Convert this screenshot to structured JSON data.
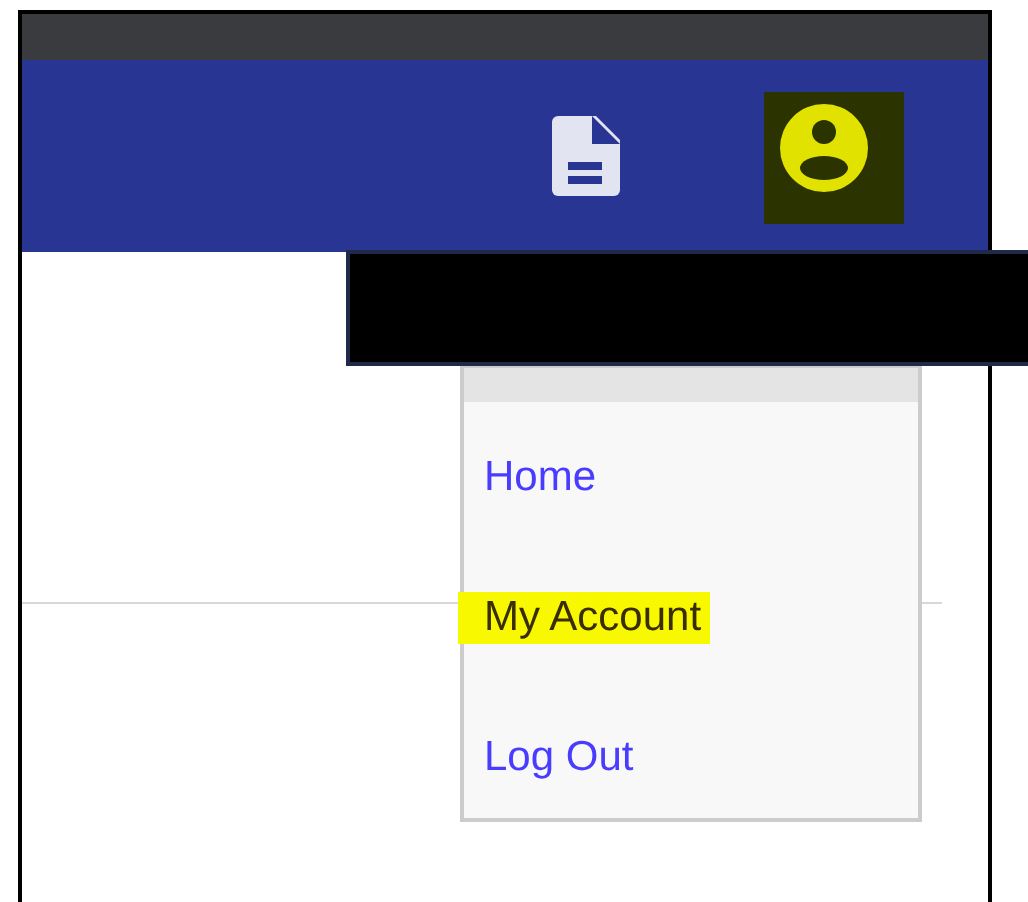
{
  "menu": {
    "items": [
      {
        "label": "Home",
        "highlighted": false
      },
      {
        "label": "My Account",
        "highlighted": true
      },
      {
        "label": "Log Out",
        "highlighted": false
      }
    ]
  }
}
